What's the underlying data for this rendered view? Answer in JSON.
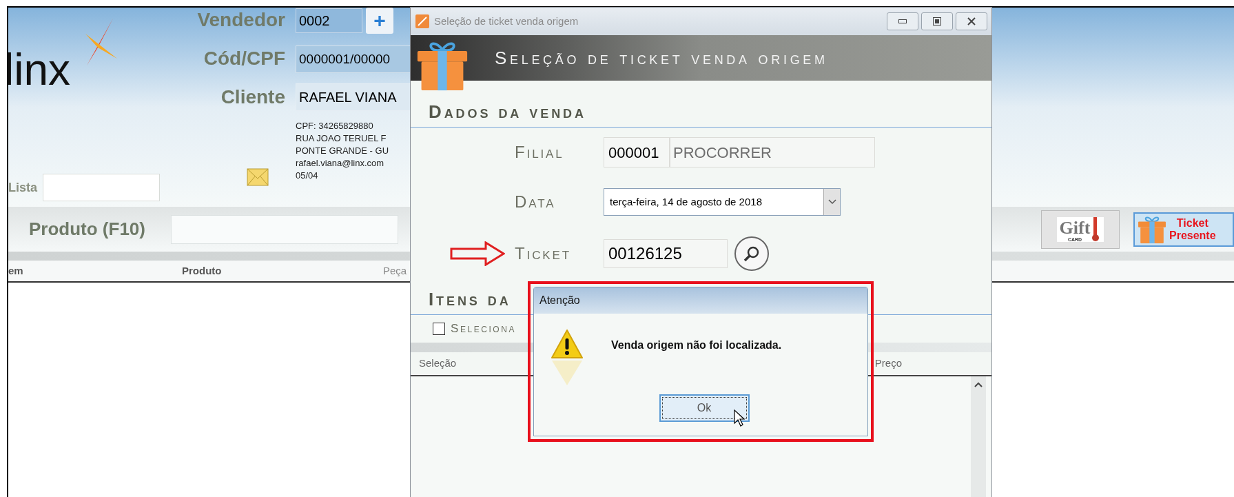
{
  "app": {
    "logo": "linx",
    "vendedor_label": "Vendedor",
    "vendedor_value": "0002",
    "add_button": "+",
    "cod_label": "Cód/CPF",
    "cod_value": "0000001/00000",
    "cliente_label": "Cliente",
    "cliente_value": "RAFAEL VIANA",
    "customer_info": [
      "CPF: 34265829880",
      "RUA JOAO TERUEL F",
      "PONTE GRANDE - GU",
      "rafael.viana@linx.com",
      "05/04"
    ],
    "lista_label": "Lista",
    "produto_label": "Produto (F10)",
    "columns": [
      "em",
      "Produto",
      "Peça"
    ],
    "gift_card_button": {
      "text": "Gift",
      "subtext": "CARD"
    },
    "ticket_button": {
      "line1": "Ticket",
      "line2": "Presente",
      "selected": true
    }
  },
  "dialog": {
    "title": "Seleção de ticket venda origem",
    "banner": "Seleção de ticket venda origem",
    "section": "Dados da venda",
    "fields": [
      {
        "kind": "code",
        "label": "Filial",
        "code": "000001",
        "value": "PROCORRER",
        "highlighted": false
      },
      {
        "kind": "date",
        "label": "Data",
        "value": "terça-feira, 14 de agosto de 2018",
        "highlighted": false
      },
      {
        "kind": "search",
        "label": "Ticket",
        "value": "00126125",
        "highlighted": true
      }
    ],
    "items_section": "Itens da",
    "select_all": {
      "label": "Seleciona",
      "checked": false
    },
    "columns": [
      "Seleção",
      "Preço"
    ]
  },
  "alert": {
    "title": "Atenção",
    "message": "Venda origem não foi localizada.",
    "button": "Ok",
    "highlighted": true
  }
}
